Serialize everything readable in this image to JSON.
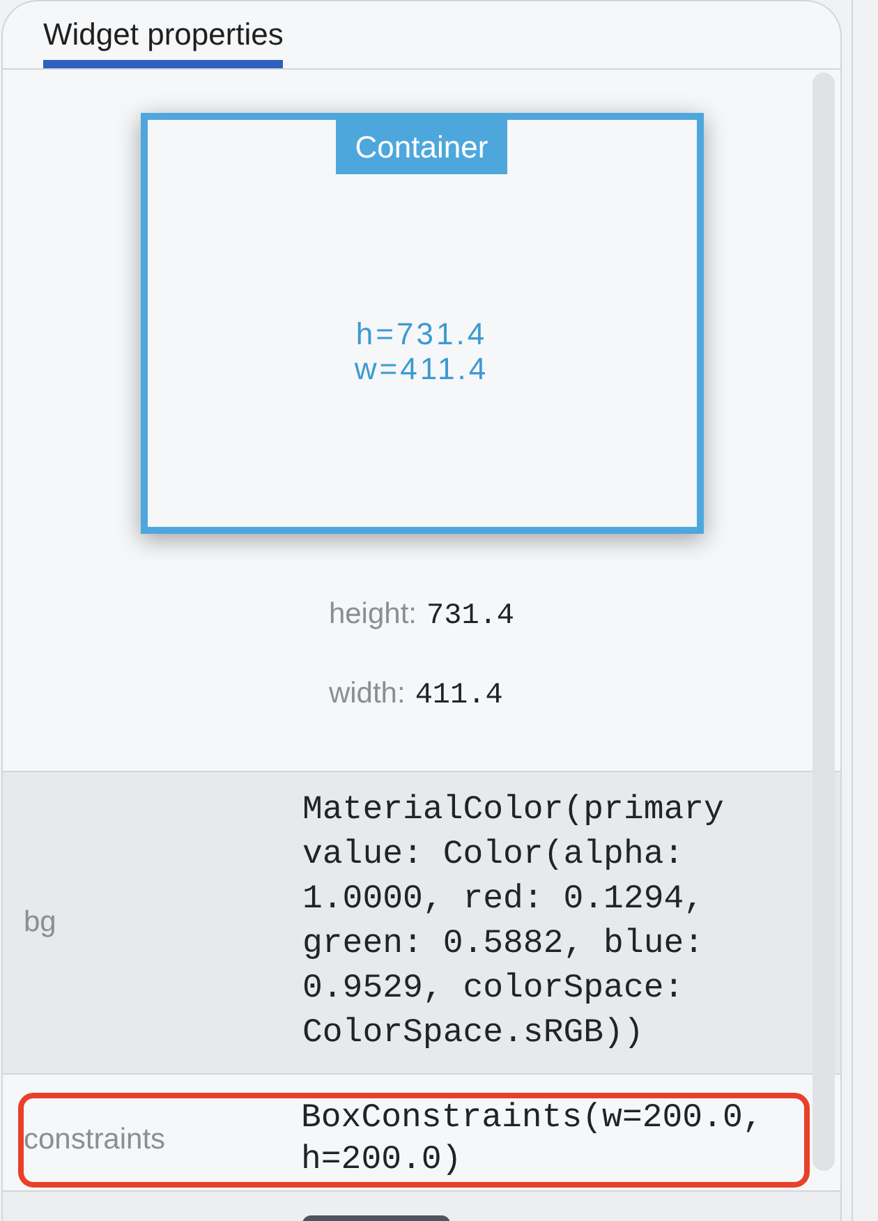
{
  "tabs": [
    {
      "label": "Widget properties",
      "selected": true
    }
  ],
  "layout_preview": {
    "widget_name": "Container",
    "height_text": "h=731.4",
    "width_text": "w=411.4"
  },
  "size": [
    {
      "label": "height:",
      "value": "731.4"
    },
    {
      "label": "width:",
      "value": "411.4"
    }
  ],
  "properties": [
    {
      "name": "bg",
      "value": "MaterialColor(primary value: Color(alpha: 1.0000, red: 0.1294, green: 0.5882, blue: 0.9529, colorSpace: ColorSpace.sRGB))",
      "highlighted": true,
      "outlined": false
    },
    {
      "name": "constraints",
      "value": "BoxConstraints(w=200.0, h=200.0)",
      "highlighted": false,
      "outlined": true
    }
  ]
}
